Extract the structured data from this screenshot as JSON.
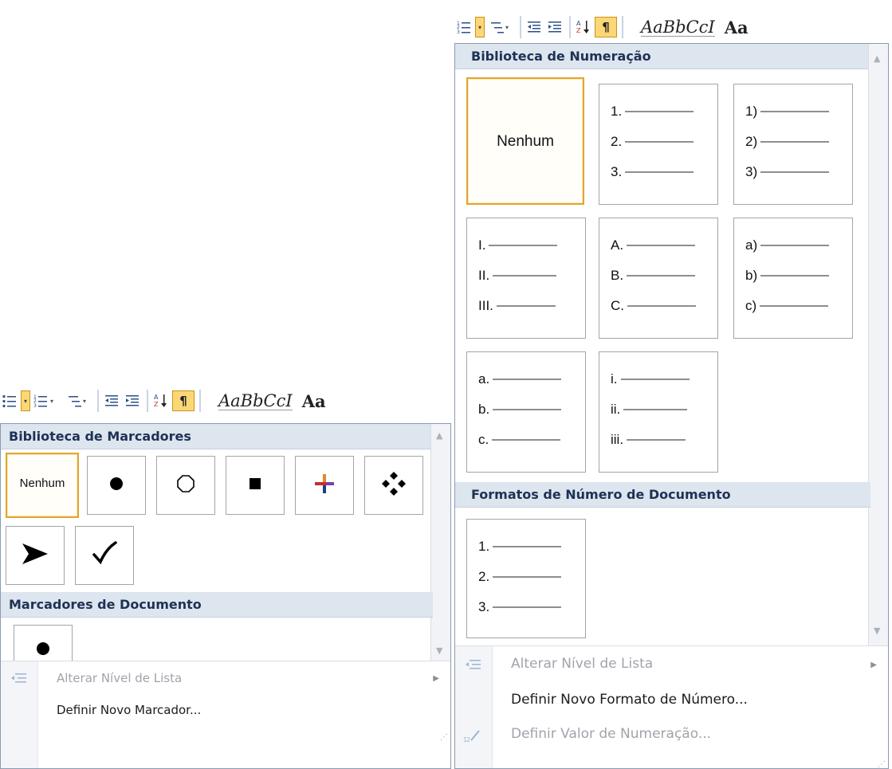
{
  "numbering": {
    "toolbar": {
      "style_preview": "AaBbCcI",
      "style_preview_2": "Aa"
    },
    "library_header": "Biblioteca de Numeração",
    "none_label": "Nenhum",
    "formats": [
      [
        "1.",
        "2.",
        "3."
      ],
      [
        "1)",
        "2)",
        "3)"
      ],
      [
        "I.",
        "II.",
        "III."
      ],
      [
        "A.",
        "B.",
        "C."
      ],
      [
        "a)",
        "b)",
        "c)"
      ],
      [
        "a.",
        "b.",
        "c."
      ],
      [
        "i.",
        "ii.",
        "iii."
      ]
    ],
    "document_header": "Formatos de Número de Documento",
    "document_formats": [
      [
        "1.",
        "2.",
        "3."
      ]
    ],
    "commands": {
      "change_level": "Alterar Nível de Lista",
      "define_format": "Definir Novo Formato de Número...",
      "set_value": "Definir Valor de Numeração..."
    }
  },
  "bullets": {
    "toolbar": {
      "style_preview": "AaBbCcI",
      "style_preview_2": "Aa"
    },
    "library_header": "Biblioteca de Marcadores",
    "none_label": "Nenhum",
    "library_icons": [
      "filled-circle",
      "hollow-circle",
      "filled-square",
      "cross-star",
      "four-diamonds",
      "arrowhead",
      "checkmark"
    ],
    "document_header": "Marcadores de Documento",
    "document_icons": [
      "filled-circle"
    ],
    "commands": {
      "change_level": "Alterar Nível de Lista",
      "define_bullet": "Definir Novo Marcador..."
    }
  }
}
